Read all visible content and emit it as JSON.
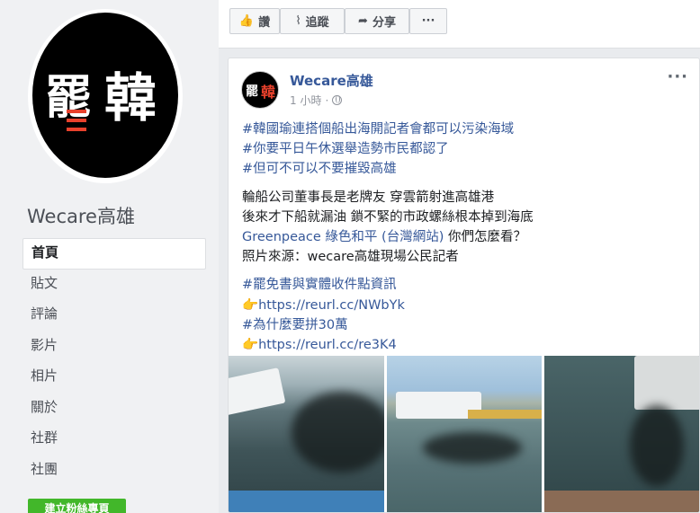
{
  "sidebar": {
    "page_name": "Wecare高雄",
    "nav": [
      {
        "label": "首頁",
        "active": true
      },
      {
        "label": "貼文"
      },
      {
        "label": "評論"
      },
      {
        "label": "影片"
      },
      {
        "label": "相片"
      },
      {
        "label": "關於"
      },
      {
        "label": "社群"
      },
      {
        "label": "社團"
      }
    ],
    "create_button": "建立粉絲專頁",
    "avatar_logo_text": "罷韓"
  },
  "actionbar": {
    "like_label": "讚",
    "follow_label": "追蹤",
    "share_label": "分享",
    "more_label": "···"
  },
  "post": {
    "author": "Wecare高雄",
    "time": "1 小時",
    "separator": "·",
    "more_label": "···",
    "lines": {
      "l1": "#韓國瑜連搭個船出海開記者會都可以污染海域",
      "l2": "#你要平日午休選舉造勢市民都認了",
      "l3": "#但可不可以不要摧毀高雄",
      "l4": "輪船公司董事長是老牌友 穿雲箭射進高雄港",
      "l5": "後來才下船就漏油 鎖不緊的市政螺絲根本掉到海底",
      "l6a": "Greenpeace 綠色和平 (台灣網站)",
      "l6b": " 你們怎麼看？",
      "l7": "照片來源：wecare高雄現場公民記者",
      "l8": "#罷免書與實體收件點資訊",
      "l9_emoji": "👉",
      "l9": "https://reurl.cc/NWbYk",
      "l10": "#為什麼要拼30萬",
      "l11_emoji": "👉",
      "l11": "https://reurl.cc/re3K4"
    }
  },
  "colors": {
    "link": "#365899",
    "accent_green": "#42b72a",
    "background": "#e9ebee"
  }
}
